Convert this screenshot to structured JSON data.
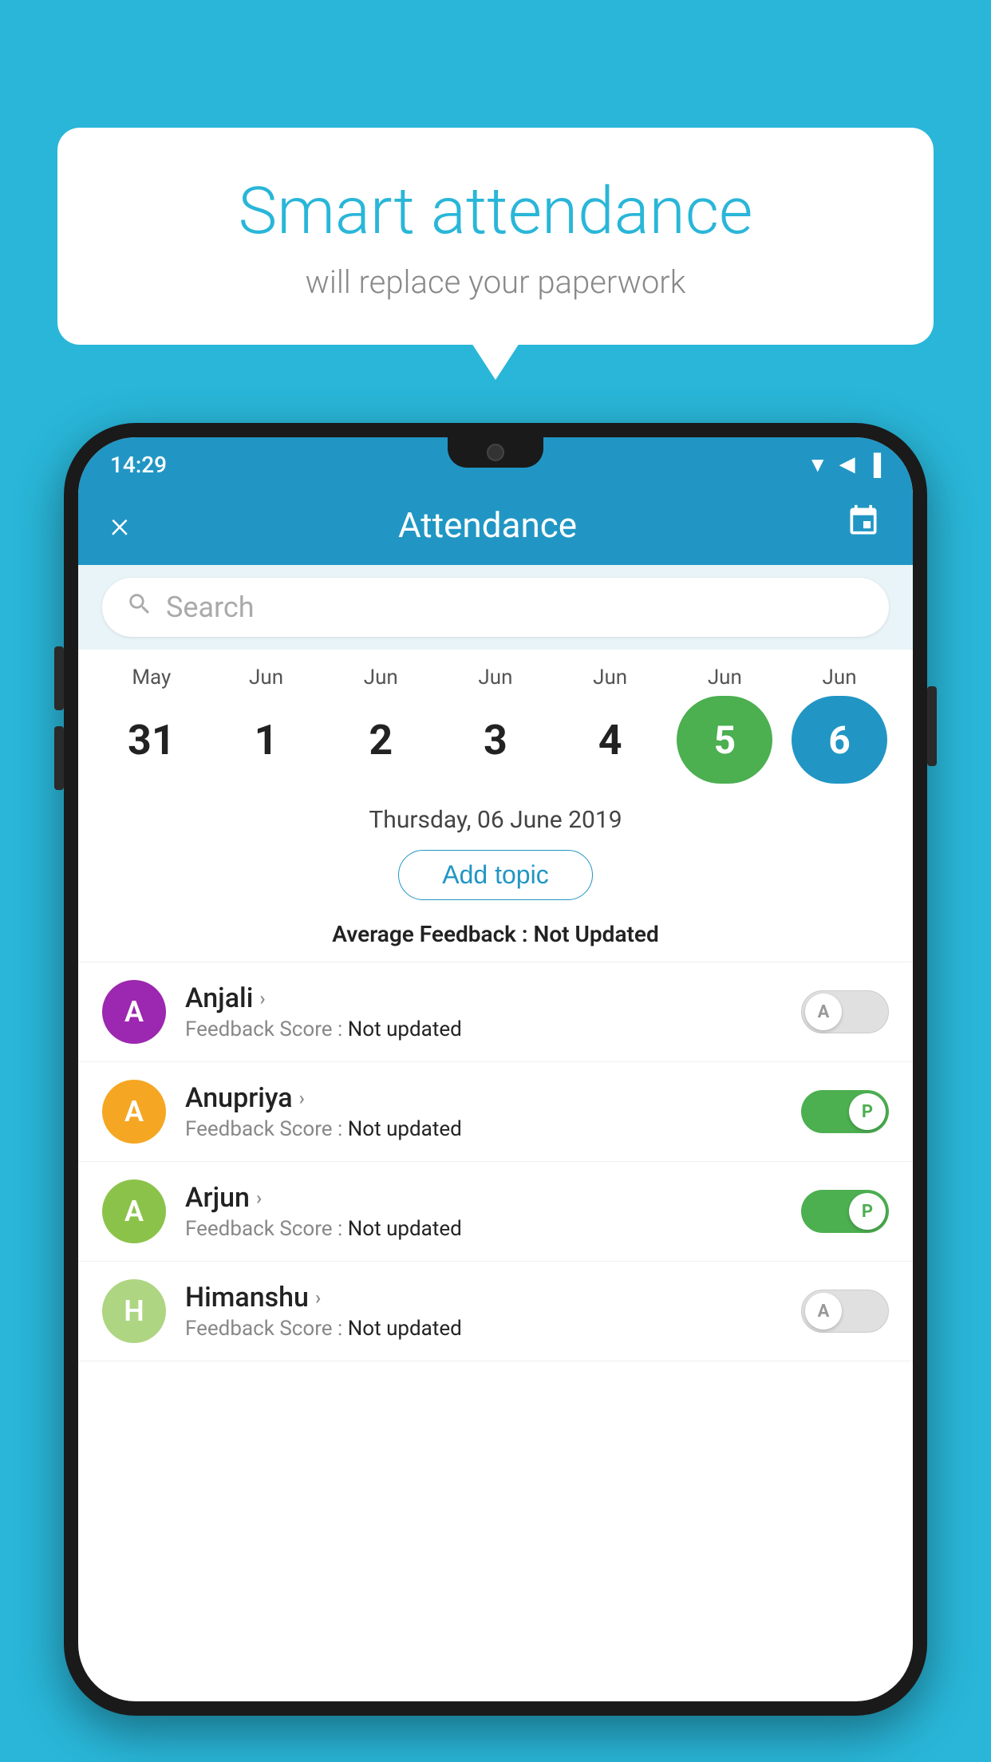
{
  "background_color": "#29b6d8",
  "speech_bubble": {
    "title": "Smart attendance",
    "subtitle": "will replace your paperwork"
  },
  "status_bar": {
    "time": "14:29",
    "wifi": "▼",
    "signal": "▲",
    "battery": "▐"
  },
  "app_bar": {
    "title": "Attendance",
    "close_label": "×",
    "calendar_icon": "📅"
  },
  "search": {
    "placeholder": "Search"
  },
  "calendar": {
    "months": [
      "May",
      "Jun",
      "Jun",
      "Jun",
      "Jun",
      "Jun",
      "Jun"
    ],
    "dates": [
      "31",
      "1",
      "2",
      "3",
      "4",
      "5",
      "6"
    ],
    "today_index": 5,
    "selected_index": 6
  },
  "selected_date_label": "Thursday, 06 June 2019",
  "add_topic_label": "Add topic",
  "avg_feedback_label": "Average Feedback : ",
  "avg_feedback_value": "Not Updated",
  "students": [
    {
      "name": "Anjali",
      "avatar_letter": "A",
      "avatar_color": "#9c27b0",
      "feedback_label": "Feedback Score : ",
      "feedback_value": "Not updated",
      "toggle": "off",
      "toggle_letter": "A"
    },
    {
      "name": "Anupriya",
      "avatar_letter": "A",
      "avatar_color": "#f5a623",
      "feedback_label": "Feedback Score : ",
      "feedback_value": "Not updated",
      "toggle": "on",
      "toggle_letter": "P"
    },
    {
      "name": "Arjun",
      "avatar_letter": "A",
      "avatar_color": "#8bc34a",
      "feedback_label": "Feedback Score : ",
      "feedback_value": "Not updated",
      "toggle": "on",
      "toggle_letter": "P"
    },
    {
      "name": "Himanshu",
      "avatar_letter": "H",
      "avatar_color": "#aed581",
      "feedback_label": "Feedback Score : ",
      "feedback_value": "Not updated",
      "toggle": "off",
      "toggle_letter": "A"
    }
  ]
}
